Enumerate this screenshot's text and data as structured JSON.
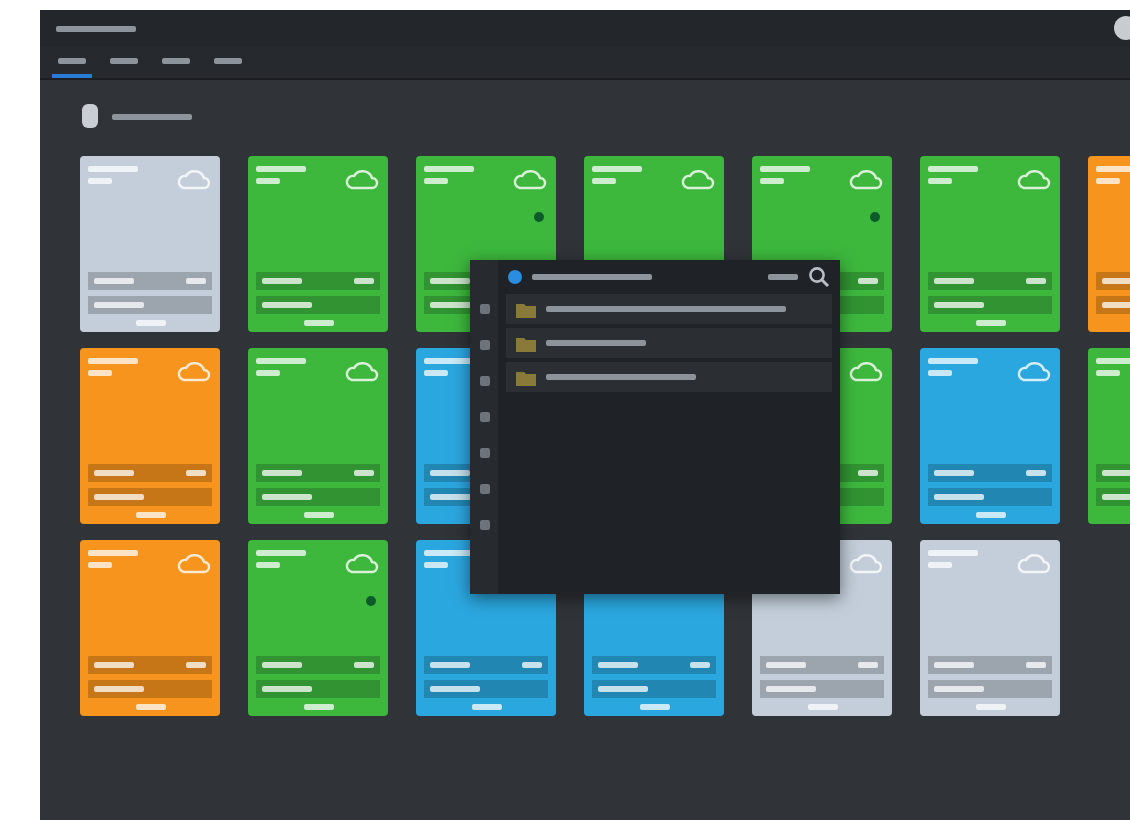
{
  "tabs": [
    {
      "selected": true
    },
    {
      "selected": false
    },
    {
      "selected": false
    },
    {
      "selected": false
    }
  ],
  "card_rows": [
    [
      {
        "color": "#c3ceda",
        "alert": false
      },
      {
        "color": "#3db83d",
        "alert": false
      },
      {
        "color": "#3db83d",
        "alert": true
      },
      {
        "color": "#3db83d",
        "alert": false
      },
      {
        "color": "#3db83d",
        "alert": true
      },
      {
        "color": "#3db83d",
        "alert": false
      },
      {
        "color": "#f7941d"
      }
    ],
    [
      {
        "color": "#f7941d",
        "alert": false
      },
      {
        "color": "#3db83d",
        "alert": false
      },
      {
        "color": "#2ba7df"
      },
      null,
      {
        "color": "#3db83d",
        "alert": false
      },
      {
        "color": "#2ba7df",
        "alert": false
      },
      {
        "color": "#3db83d"
      }
    ],
    [
      {
        "color": "#f7941d",
        "alert": false
      },
      {
        "color": "#3db83d",
        "alert": true
      },
      {
        "color": "#2ba7df",
        "alert": false
      },
      {
        "color": "#2ba7df",
        "alert": false
      },
      {
        "color": "#c3ceda",
        "alert": false
      },
      {
        "color": "#c3ceda",
        "alert": false
      }
    ]
  ],
  "popup": {
    "rows": [
      {
        "kind": "folder"
      },
      {
        "kind": "folder"
      },
      {
        "kind": "folder"
      }
    ]
  }
}
